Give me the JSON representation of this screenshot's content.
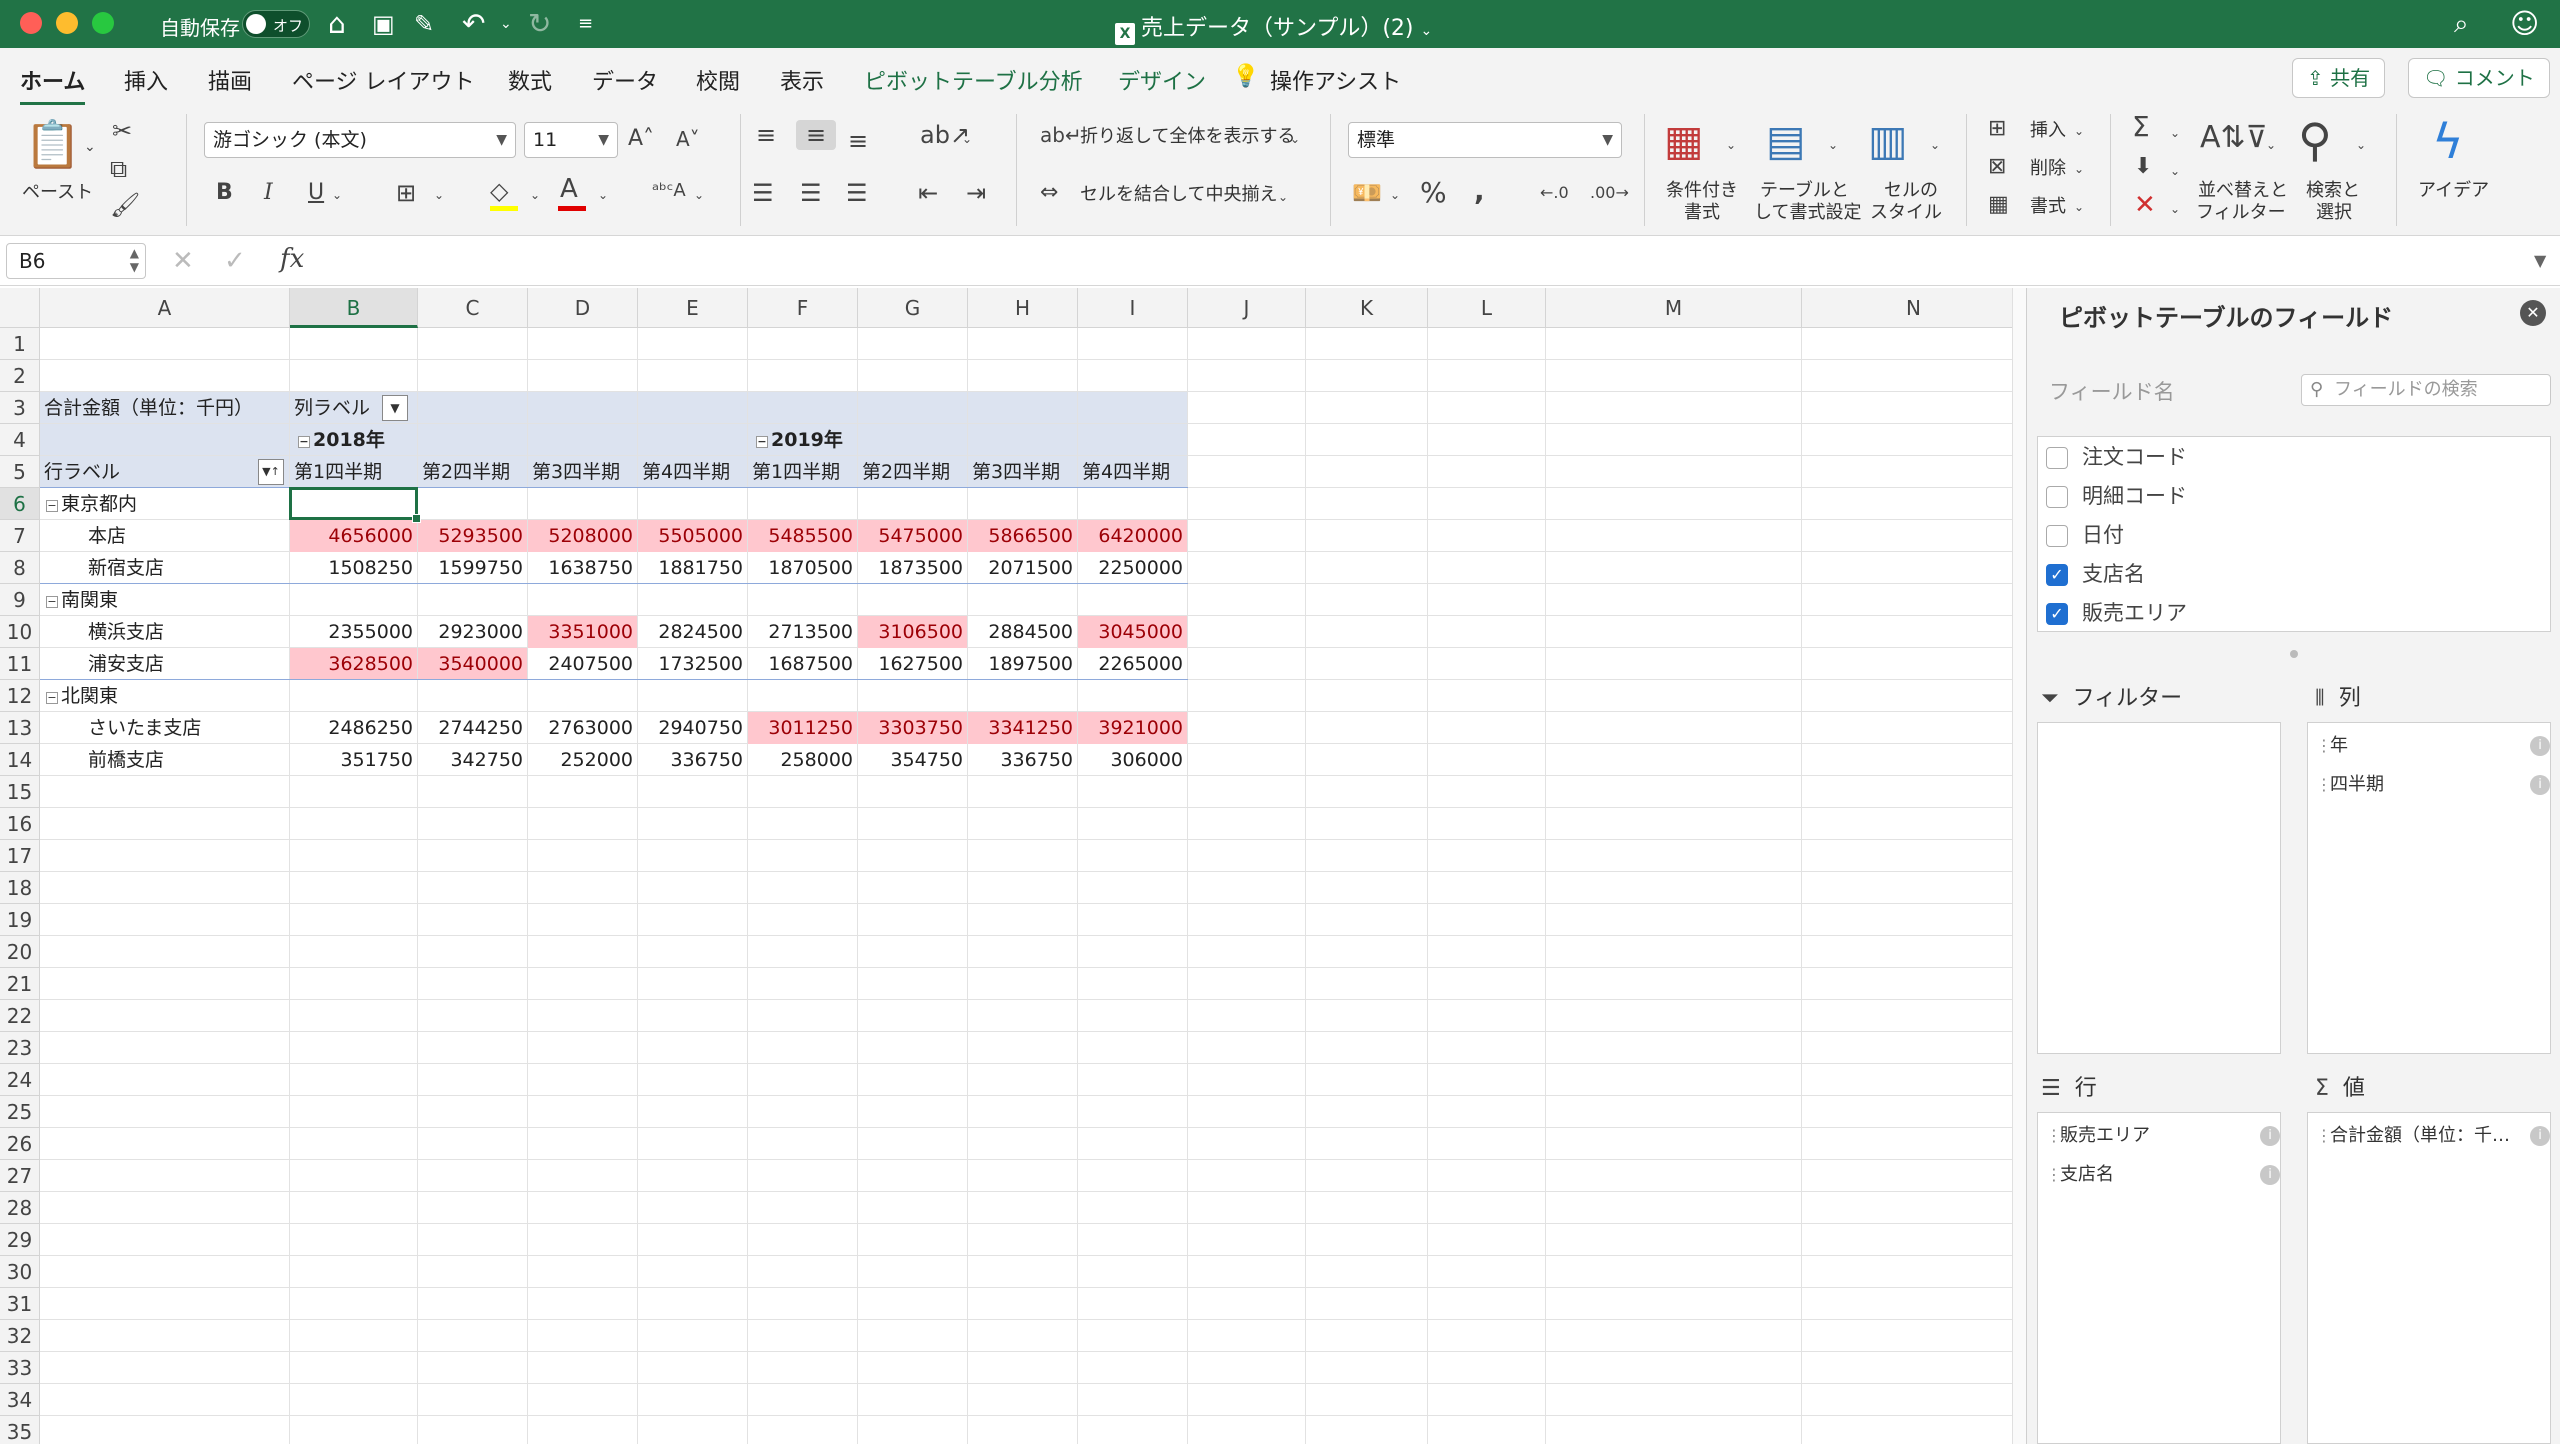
{
  "titlebar": {
    "autosave_label": "自動保存",
    "autosave_state": "オフ",
    "doc_title": "売上データ（サンプル）(2)",
    "doc_title_caret": "⌄"
  },
  "tabs": [
    "ホーム",
    "挿入",
    "描画",
    "ページ レイアウト",
    "数式",
    "データ",
    "校閲",
    "表示",
    "ピボットテーブル分析",
    "デザイン"
  ],
  "tell_me": "操作アシスト",
  "share_label": "共有",
  "comment_label": "コメント",
  "ribbon": {
    "paste_label": "ペースト",
    "font_name": "游ゴシック (本文)",
    "font_size": "11",
    "wrap_text_label": "折り返して全体を表示する",
    "merge_center_label": "セルを結合して中央揃え",
    "number_format": "標準",
    "cond_format_label_1": "条件付き",
    "cond_format_label_2": "書式",
    "table_format_label_1": "テーブルと",
    "table_format_label_2": "して書式設定",
    "cell_style_label_1": "セルの",
    "cell_style_label_2": "スタイル",
    "insert_label": "挿入",
    "delete_label": "削除",
    "format_label": "書式",
    "sort_filter_label_1": "並べ替えと",
    "sort_filter_label_2": "フィルター",
    "find_select_label_1": "検索と",
    "find_select_label_2": "選択",
    "ideas_label": "アイデア",
    "bold": "B",
    "italic": "I",
    "underline": "U"
  },
  "formula_bar": {
    "name_box": "B6",
    "fx": "fx",
    "content": ""
  },
  "grid": {
    "columns": [
      "A",
      "B",
      "C",
      "D",
      "E",
      "F",
      "G",
      "H",
      "I",
      "J",
      "K",
      "L",
      "M",
      "N"
    ],
    "row_count": 35,
    "selected_col": "B",
    "selected_row": 6
  },
  "pivot": {
    "value_caption": "合計金額（単位：千円）",
    "col_labels_caption": "列ラベル",
    "row_labels_caption": "行ラベル",
    "year_2018": "2018年",
    "year_2019": "2019年",
    "quarters": [
      "第1四半期",
      "第2四半期",
      "第3四半期",
      "第4四半期",
      "第1四半期",
      "第2四半期",
      "第3四半期",
      "第4四半期"
    ],
    "groups": [
      {
        "name": "東京都内",
        "rows": [
          {
            "name": "本店",
            "values": [
              "4656000",
              "5293500",
              "5208000",
              "5505000",
              "5485500",
              "5475000",
              "5866500",
              "6420000"
            ],
            "highlight": [
              true,
              true,
              true,
              true,
              true,
              true,
              true,
              true
            ]
          },
          {
            "name": "新宿支店",
            "values": [
              "1508250",
              "1599750",
              "1638750",
              "1881750",
              "1870500",
              "1873500",
              "2071500",
              "2250000"
            ],
            "highlight": [
              false,
              false,
              false,
              false,
              false,
              false,
              false,
              false
            ]
          }
        ]
      },
      {
        "name": "南関東",
        "rows": [
          {
            "name": "横浜支店",
            "values": [
              "2355000",
              "2923000",
              "3351000",
              "2824500",
              "2713500",
              "3106500",
              "2884500",
              "3045000"
            ],
            "highlight": [
              false,
              false,
              true,
              false,
              false,
              true,
              false,
              true
            ]
          },
          {
            "name": "浦安支店",
            "values": [
              "3628500",
              "3540000",
              "2407500",
              "1732500",
              "1687500",
              "1627500",
              "1897500",
              "2265000"
            ],
            "highlight": [
              true,
              true,
              false,
              false,
              false,
              false,
              false,
              false
            ]
          }
        ]
      },
      {
        "name": "北関東",
        "rows": [
          {
            "name": "さいたま支店",
            "values": [
              "2486250",
              "2744250",
              "2763000",
              "2940750",
              "3011250",
              "3303750",
              "3341250",
              "3921000"
            ],
            "highlight": [
              false,
              false,
              false,
              false,
              true,
              true,
              true,
              true
            ]
          },
          {
            "name": "前橋支店",
            "values": [
              "351750",
              "342750",
              "252000",
              "336750",
              "258000",
              "354750",
              "336750",
              "306000"
            ],
            "highlight": [
              false,
              false,
              false,
              false,
              false,
              false,
              false,
              false
            ]
          }
        ]
      }
    ]
  },
  "panel": {
    "title": "ピボットテーブルのフィールド",
    "field_name_label": "フィールド名",
    "search_placeholder": "フィールドの検索",
    "fields": [
      {
        "name": "注文コード",
        "checked": false
      },
      {
        "name": "明細コード",
        "checked": false
      },
      {
        "name": "日付",
        "checked": false
      },
      {
        "name": "支店名",
        "checked": true
      },
      {
        "name": "販売エリア",
        "checked": true
      }
    ],
    "filters_title": "フィルター",
    "columns_title": "列",
    "rows_title": "行",
    "values_title": "値",
    "column_items": [
      "年",
      "四半期"
    ],
    "row_items": [
      "販売エリア",
      "支店名"
    ],
    "value_items": [
      "合計金額（単位：千…"
    ]
  }
}
